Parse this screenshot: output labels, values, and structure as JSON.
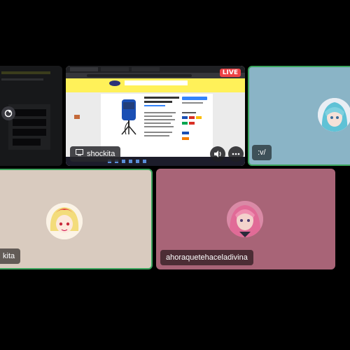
{
  "tiles": {
    "left_stream": {
      "name": ""
    },
    "screen_share": {
      "name": "shockita",
      "live_label": "LIVE",
      "browser": {
        "site_logo": "mercado libre",
        "product_title": "Micrófono Fifine K669B USB Condensador",
        "buy_button": "Comprar ahora",
        "cart_button": "Agregar al carrito"
      }
    },
    "blue_user": {
      "name": ":v/"
    },
    "beige_user": {
      "name": "kita"
    },
    "rose_user": {
      "name": "ahoraquetehaceladivina"
    }
  },
  "colors": {
    "speaking_border": "#3ba55d",
    "live_red": "#ed4245",
    "blue_tile": "#8ab4c6",
    "beige_tile": "#d9cbbf",
    "rose_tile": "#a86477"
  },
  "icons": [
    "monitor-icon",
    "volume-icon",
    "more-icon",
    "add-activity-icon"
  ]
}
